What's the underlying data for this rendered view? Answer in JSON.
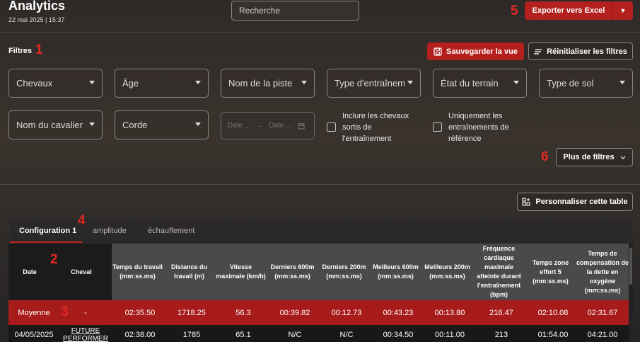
{
  "header": {
    "title": "Analytics",
    "datetime": "22 mai 2025 | 15:37",
    "search_placeholder": "Recherche",
    "export_label": "Exporter vers Excel"
  },
  "markers": [
    "1",
    "2",
    "3",
    "4",
    "5",
    "6"
  ],
  "filters": {
    "label": "Filtres",
    "save_label": "Sauvegarder la vue",
    "reset_label": "Réinitialiser les filtres",
    "selects_row1": [
      "Chevaux",
      "Âge",
      "Nom de la piste",
      "Type d'entraînement",
      "État du terrain",
      "Type de sol"
    ],
    "selects_row2": [
      "Nom du cavalier",
      "Corde"
    ],
    "date_start_placeholder": "Date ...",
    "date_end_placeholder": "Date ...",
    "checkbox_out": "Inclure les chevaux sortis de l'entraînement",
    "checkbox_ref": "Uniquement les entraînements de référence",
    "more_label": "Plus de filtres"
  },
  "table": {
    "customize_label": "Personnaliser cette table",
    "tabs": [
      "Configuration 1",
      "amplitude",
      "échauffement"
    ],
    "active_tab": "Configuration 1",
    "fixed_headers": [
      "Date",
      "Cheval"
    ],
    "headers": [
      "Temps du travail (mm:ss.ms)",
      "Distance du travail (m)",
      "Vitesse maximale (km/h)",
      "Derniers 600m (mm:ss.ms)",
      "Derniers 200m (mm:ss.ms)",
      "Meilleurs 600m (mm:ss.ms)",
      "Meilleurs 200m (mm:ss.ms)",
      "Fréquence cardiaque maximale atteinte durant l'entraînement (bpm)",
      "Temps zone effort 5 (mm:ss.ms)",
      "Temps de compensation de la dette en oxygène (mm:ss.ms)"
    ],
    "average_row": {
      "date": "Moyenne",
      "cheval": "-",
      "values": [
        "02:35.50",
        "1718.25",
        "56.3",
        "00:39.82",
        "00:12.73",
        "00:43.23",
        "00:13.80",
        "216.47",
        "02:10.08",
        "02:31.67"
      ]
    },
    "rows": [
      {
        "date": "04/05/2025",
        "cheval": "FUTURE PERFORMER",
        "values": [
          "02:38.00",
          "1785",
          "65.1",
          "N/C",
          "N/C",
          "00:34.50",
          "00:11.00",
          "213",
          "01:54.00",
          "04:21.00"
        ]
      }
    ]
  }
}
